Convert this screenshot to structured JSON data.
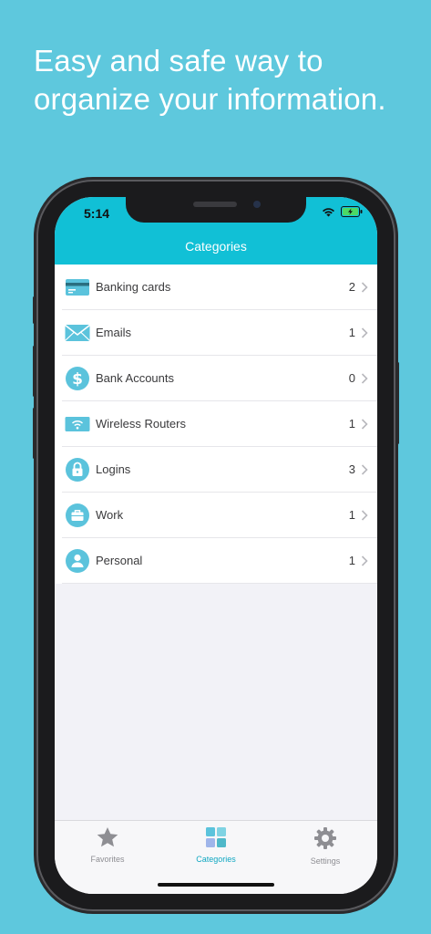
{
  "headline": {
    "line1": "Easy and safe way to",
    "line2": "organize your information."
  },
  "status_bar": {
    "time": "5:14"
  },
  "nav": {
    "title": "Categories"
  },
  "categories": [
    {
      "label": "Banking cards",
      "count": "2",
      "icon": "credit-card-icon"
    },
    {
      "label": "Emails",
      "count": "1",
      "icon": "envelope-icon"
    },
    {
      "label": "Bank Accounts",
      "count": "0",
      "icon": "dollar-icon"
    },
    {
      "label": "Wireless Routers",
      "count": "1",
      "icon": "wifi-router-icon"
    },
    {
      "label": "Logins",
      "count": "3",
      "icon": "lock-icon"
    },
    {
      "label": "Work",
      "count": "1",
      "icon": "briefcase-icon"
    },
    {
      "label": "Personal",
      "count": "1",
      "icon": "person-icon"
    }
  ],
  "tabs": [
    {
      "label": "Favorites",
      "icon": "star-icon",
      "active": false
    },
    {
      "label": "Categories",
      "icon": "grid-icon",
      "active": true
    },
    {
      "label": "Settings",
      "icon": "gear-icon",
      "active": false
    }
  ],
  "colors": {
    "background": "#5ec8dd",
    "header": "#11c0d6",
    "icon_accent": "#5bc3dc",
    "active_tab": "#11a8c2"
  }
}
